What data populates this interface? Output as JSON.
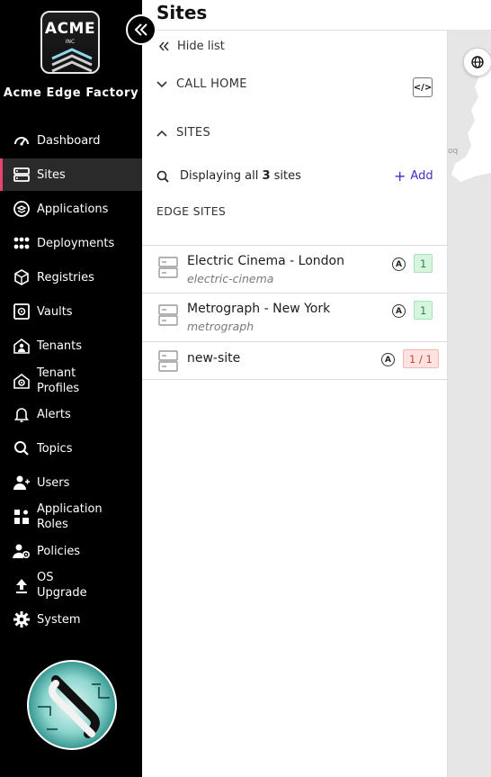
{
  "header": {
    "title": "Sites"
  },
  "sidebar": {
    "logo_text": "ACME",
    "logo_sub": "INC",
    "company": "Acme Edge Factory",
    "items": [
      {
        "label": "Dashboard",
        "icon": "dashboard-icon",
        "active": false
      },
      {
        "label": "Sites",
        "icon": "server-icon",
        "active": true
      },
      {
        "label": "Applications",
        "icon": "applications-icon",
        "active": false
      },
      {
        "label": "Deployments",
        "icon": "deployments-icon",
        "active": false
      },
      {
        "label": "Registries",
        "icon": "registries-icon",
        "active": false
      },
      {
        "label": "Vaults",
        "icon": "vault-icon",
        "active": false
      },
      {
        "label": "Tenants",
        "icon": "tenants-icon",
        "active": false
      },
      {
        "label": "Tenant\nProfiles",
        "icon": "tenant-profiles-icon",
        "active": false
      },
      {
        "label": "Alerts",
        "icon": "bell-icon",
        "active": false
      },
      {
        "label": "Topics",
        "icon": "search-icon",
        "active": false
      },
      {
        "label": "Users",
        "icon": "users-icon",
        "active": false
      },
      {
        "label": "Application\nRoles",
        "icon": "application-roles-icon",
        "active": false
      },
      {
        "label": "Policies",
        "icon": "policies-icon",
        "active": false
      },
      {
        "label": "OS\nUpgrade",
        "icon": "upload-icon",
        "active": false
      },
      {
        "label": "System",
        "icon": "gear-icon",
        "active": false
      }
    ]
  },
  "panel": {
    "hide_list": "Hide list",
    "call_home": "CALL HOME",
    "embed_label": "</>",
    "sites_section": "SITES",
    "display_prefix": "Displaying all ",
    "display_count": "3",
    "display_suffix": " sites",
    "add_label": "Add",
    "edge_sites": "EDGE SITES"
  },
  "sites": [
    {
      "name": "Electric Cinema - London",
      "slug": "electric-cinema",
      "mode": "A",
      "count": "1",
      "status": "ok"
    },
    {
      "name": "Metrograph - New York",
      "slug": "metrograph",
      "mode": "A",
      "count": "1",
      "status": "ok"
    },
    {
      "name": "new-site",
      "slug": "",
      "mode": "A",
      "count": "1 / 1",
      "status": "bad"
    }
  ],
  "map": {
    "label": "oq"
  },
  "colors": {
    "accent": "#e8436a",
    "link": "#3b2fc9",
    "ok": "#1f8a3d",
    "bad": "#c04a3a"
  }
}
